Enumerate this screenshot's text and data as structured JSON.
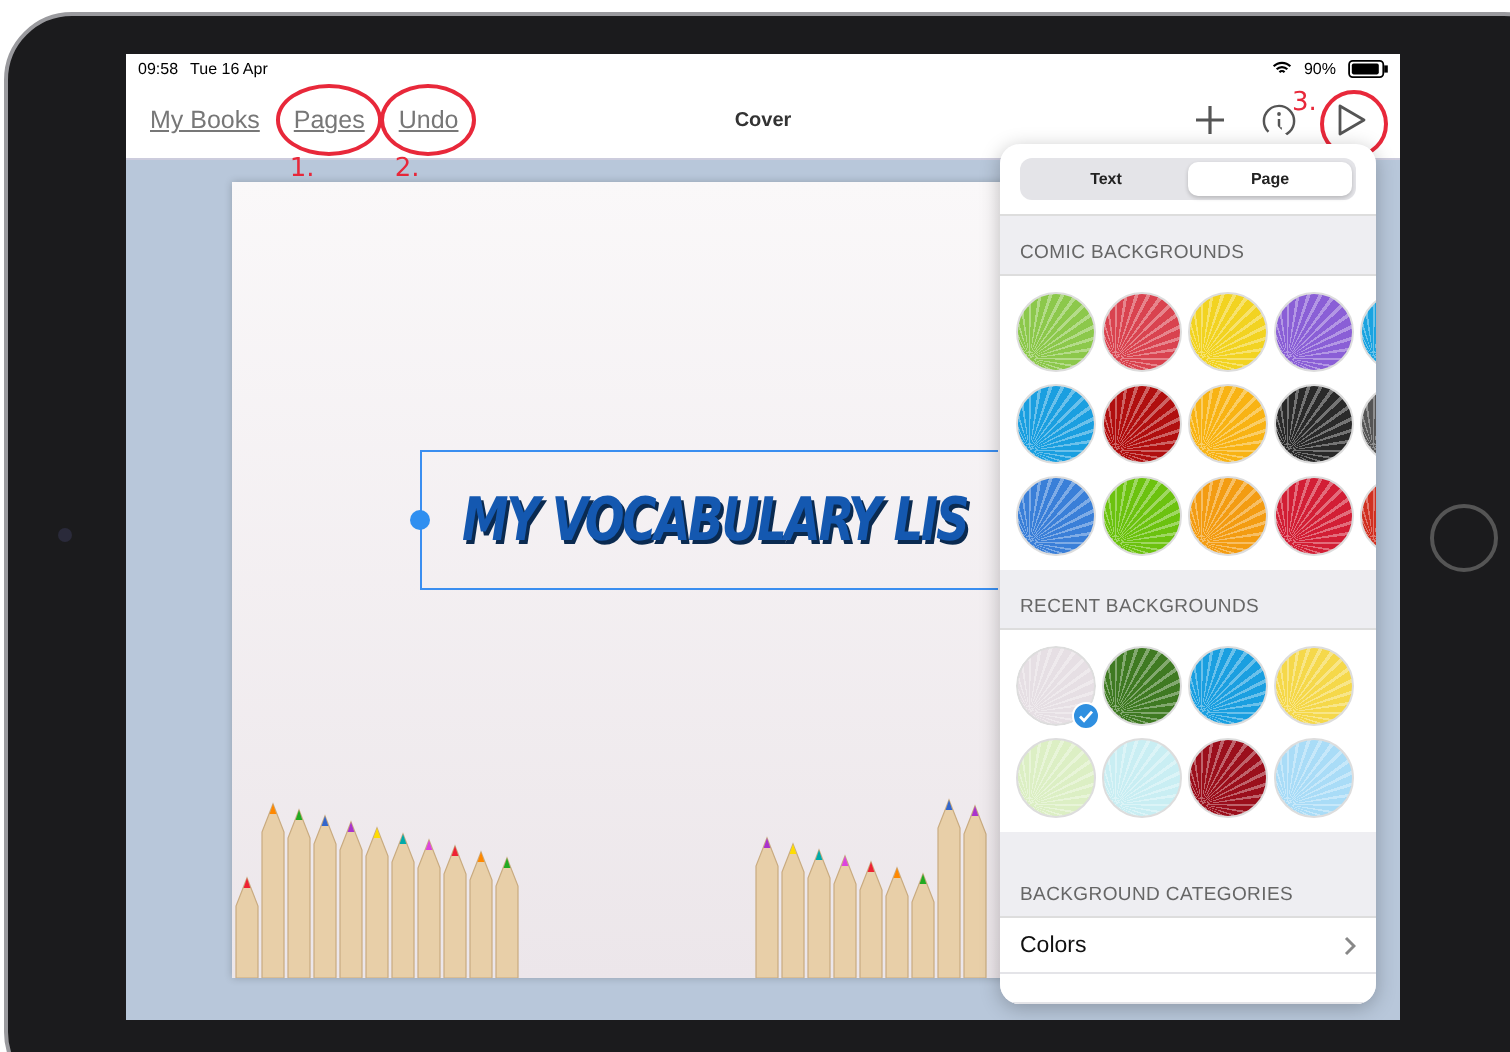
{
  "status_bar": {
    "time": "09:58",
    "date": "Tue 16 Apr",
    "battery": "90%"
  },
  "nav_bar": {
    "left_links": [
      {
        "label": "My Books"
      },
      {
        "label": "Pages",
        "annotation": "1."
      },
      {
        "label": "Undo",
        "annotation": "2."
      }
    ],
    "title": "Cover",
    "play_annotation": "3."
  },
  "page": {
    "title_text": "MY VOCABULARY LIS"
  },
  "popover": {
    "tabs": [
      {
        "label": "Text",
        "selected": false
      },
      {
        "label": "Page",
        "selected": true
      }
    ],
    "sections": [
      {
        "heading": "COMIC BACKGROUNDS",
        "swatches": [
          {
            "color": "#8cc84b"
          },
          {
            "color": "#d9434f"
          },
          {
            "color": "#f2d321"
          },
          {
            "color": "#8a5fd6"
          },
          {
            "color": "#1aa3e0"
          },
          {
            "color": "#1a9fe0"
          },
          {
            "color": "#b00f0f"
          },
          {
            "color": "#f8b314"
          },
          {
            "color": "#2a2a2a"
          },
          {
            "color": "#555555"
          },
          {
            "color": "#3a7fd8"
          },
          {
            "color": "#6cc20f"
          },
          {
            "color": "#f39c12"
          },
          {
            "color": "#d21e35"
          },
          {
            "color": "#d03020"
          }
        ]
      },
      {
        "heading": "RECENT BACKGROUNDS",
        "swatches": [
          {
            "color": "#e6dfe4",
            "selected": true
          },
          {
            "color": "#3f7a22",
            "selected": false
          },
          {
            "color": "#1a9fe0",
            "selected": false
          },
          {
            "color": "#f5d84a",
            "selected": false
          },
          {
            "color": "#dcefc4",
            "selected": false
          },
          {
            "color": "#c9eef3",
            "selected": false
          },
          {
            "color": "#9b0f1c",
            "selected": false
          },
          {
            "color": "#a9dcf7",
            "selected": false
          }
        ]
      }
    ],
    "categories": {
      "heading": "BACKGROUND CATEGORIES",
      "items": [
        "Colors"
      ]
    }
  }
}
